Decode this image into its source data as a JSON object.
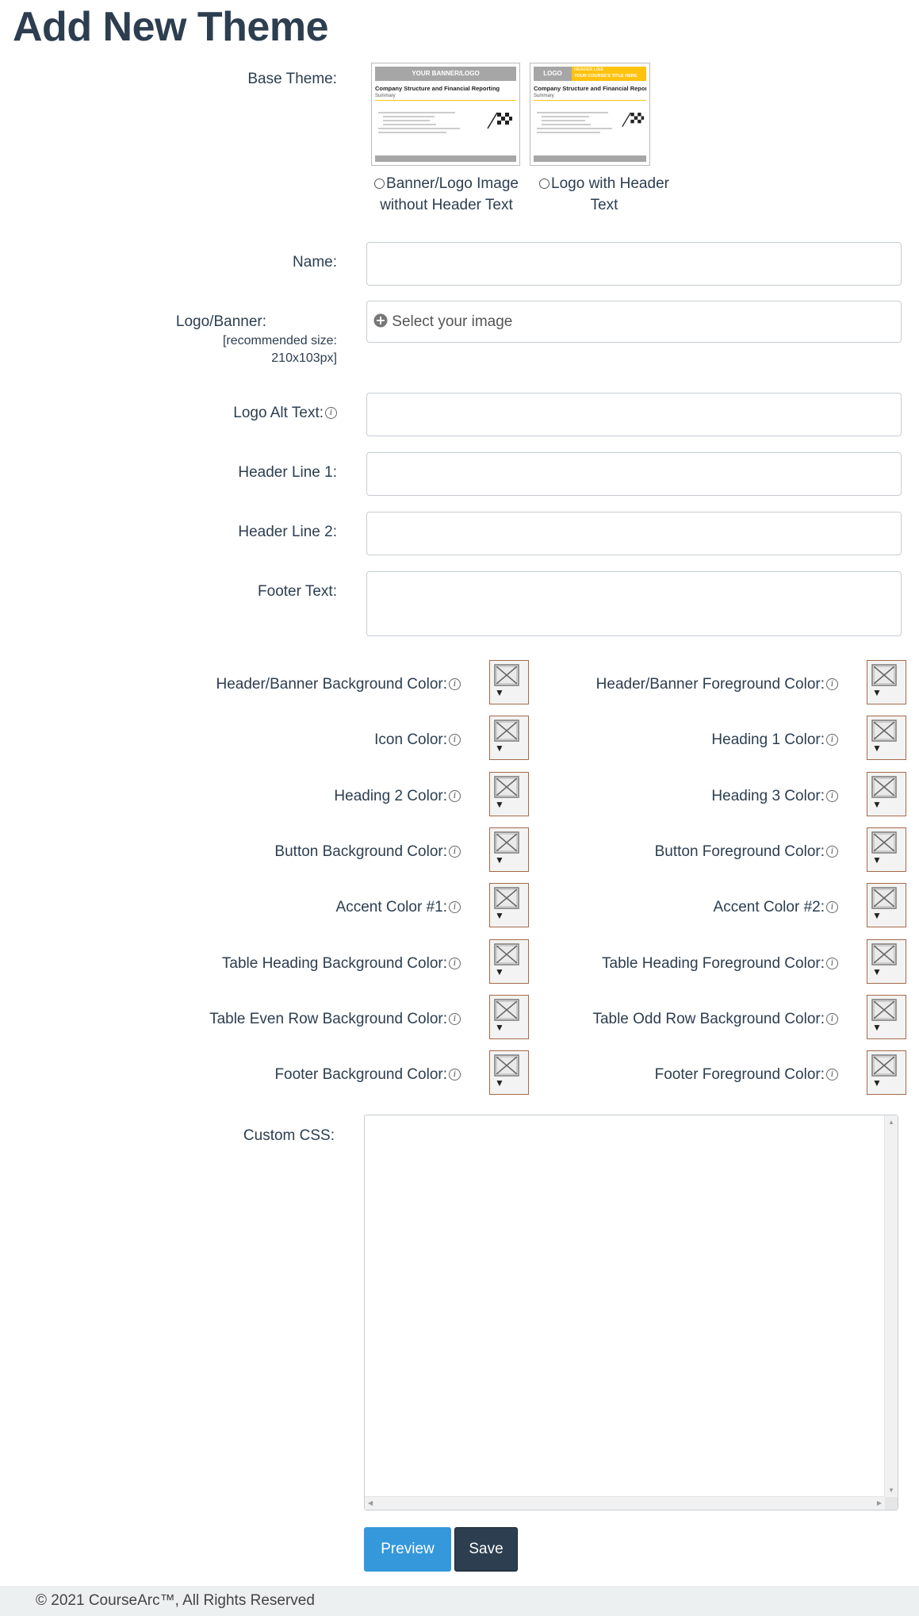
{
  "page": {
    "title": "Add New Theme"
  },
  "base_theme": {
    "label": "Base Theme:",
    "options": [
      {
        "label_line1": "Banner/Logo Image",
        "label_line2": "without Header Text",
        "thumb_banner": "YOUR BANNER/LOGO",
        "thumb_heading": "Company Structure and Financial Reporting",
        "thumb_sub": "Summary"
      },
      {
        "label_line1": "Logo with Header",
        "label_line2": "Text",
        "thumb_logo": "LOGO",
        "thumb_header_small": "HEADER LINE",
        "thumb_header": "YOUR COURSE'S TITLE HERE",
        "thumb_heading": "Company Structure and Financial Reporting",
        "thumb_sub": "Summary"
      }
    ]
  },
  "fields": {
    "name_label": "Name:",
    "logo_label": "Logo/Banner:",
    "logo_sub1": "[recommended size:",
    "logo_sub2": "210x103px]",
    "logo_placeholder": "Select your image",
    "alt_label": "Logo Alt Text:",
    "header1_label": "Header Line 1:",
    "header2_label": "Header Line 2:",
    "footer_label": "Footer Text:"
  },
  "colors_left": [
    "Header/Banner Background Color:",
    "Icon Color:",
    "Heading 2 Color:",
    "Button Background Color:",
    "Accent Color #1:",
    "Table Heading Background Color:",
    "Table Even Row Background Color:",
    "Footer Background Color:"
  ],
  "colors_right": [
    "Header/Banner Foreground Color:",
    "Heading 1 Color:",
    "Heading 3 Color:",
    "Button Foreground Color:",
    "Accent Color #2:",
    "Table Heading Foreground Color:",
    "Table Odd Row Background Color:",
    "Footer Foreground Color:"
  ],
  "custom_css": {
    "label": "Custom CSS:"
  },
  "buttons": {
    "preview": "Preview",
    "save": "Save"
  },
  "footer": {
    "copyright": "© 2021 CourseArc™, All Rights Reserved"
  },
  "style": {
    "primary": "#2c3e50",
    "preview_button": "#3498db",
    "save_button": "#2c3e50",
    "thumb_banner_gray": "#a6a6a6",
    "thumb_header_yellow": "#ffc20e"
  },
  "icons": {
    "info": "info-icon",
    "plus": "plus-circle-icon",
    "swatch": "broken-image-icon",
    "dropdown": "triangle-down-icon"
  }
}
